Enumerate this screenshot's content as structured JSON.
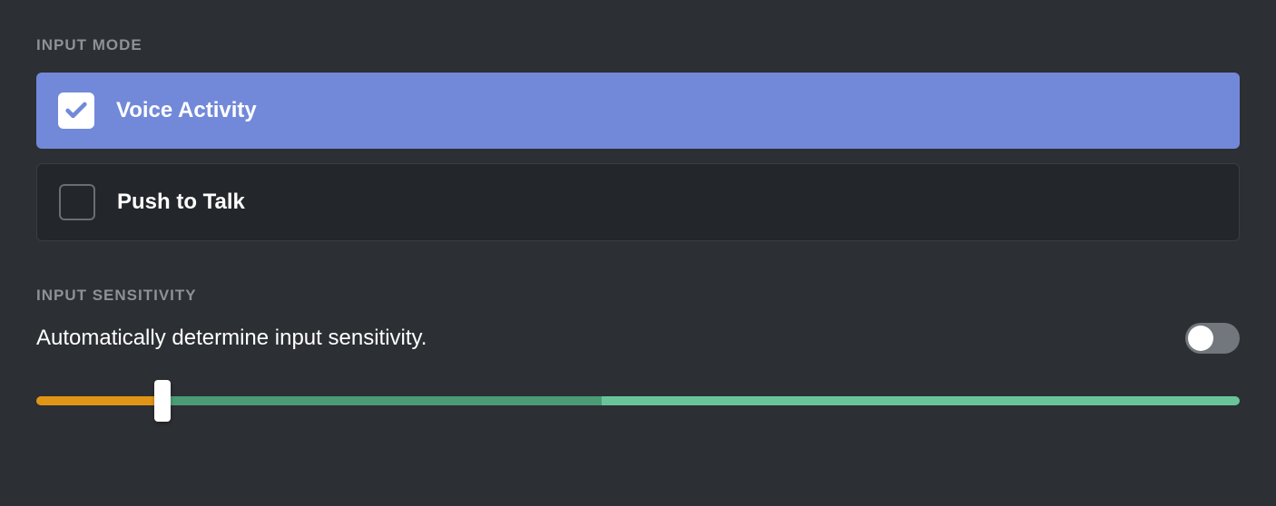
{
  "input_mode": {
    "header": "INPUT MODE",
    "options": [
      {
        "label": "Voice Activity",
        "selected": true
      },
      {
        "label": "Push to Talk",
        "selected": false
      }
    ]
  },
  "input_sensitivity": {
    "header": "INPUT SENSITIVITY",
    "auto_label": "Automatically determine input sensitivity.",
    "auto_enabled": false,
    "slider": {
      "thumb_position_pct": 10.5,
      "segments": {
        "orange_end_pct": 10.5,
        "dark_green_end_pct": 47,
        "light_green_end_pct": 100
      }
    }
  },
  "colors": {
    "accent": "#7289da",
    "orange": "#e19517",
    "dark_green": "#4b9b77",
    "light_green": "#69c49a"
  }
}
